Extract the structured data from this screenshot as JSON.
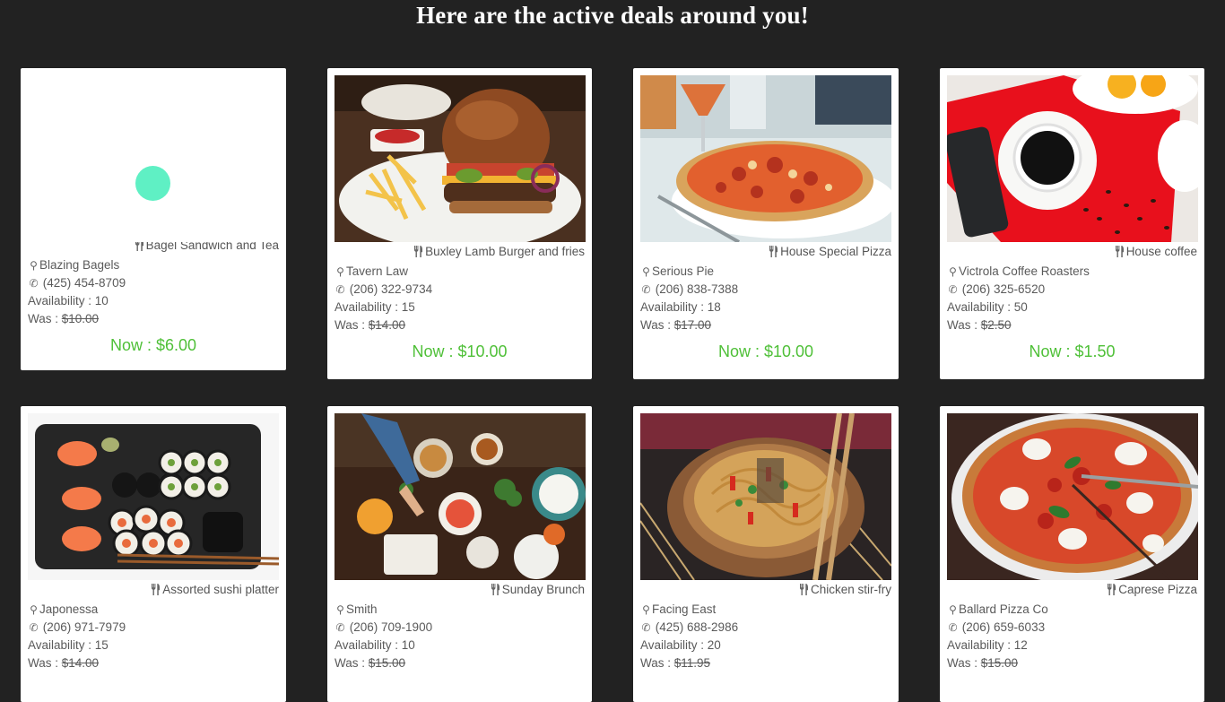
{
  "page": {
    "title": "Here are the active deals around you!"
  },
  "labels": {
    "availability": "Availability : ",
    "was": "Was : ",
    "now": "Now : "
  },
  "colors": {
    "background": "#222222",
    "price_now": "#4fc038",
    "spinner": "#5ff0c4"
  },
  "deals": [
    {
      "deal": "Bagel Sandwich and Tea",
      "restaurant": "Blazing Bagels",
      "phone": "(425) 454-8709",
      "availability": "10",
      "was": "$10.00",
      "now": "$6.00",
      "image": "loading-spinner"
    },
    {
      "deal": "Buxley Lamb Burger and fries",
      "restaurant": "Tavern Law",
      "phone": "(206) 322-9734",
      "availability": "15",
      "was": "$14.00",
      "now": "$10.00",
      "image": "burger-photo"
    },
    {
      "deal": "House Special Pizza",
      "restaurant": "Serious Pie",
      "phone": "(206) 838-7388",
      "availability": "18",
      "was": "$17.00",
      "now": "$10.00",
      "image": "pizza-photo"
    },
    {
      "deal": "House coffee",
      "restaurant": "Victrola Coffee Roasters",
      "phone": "(206) 325-6520",
      "availability": "50",
      "was": "$2.50",
      "now": "$1.50",
      "image": "coffee-photo"
    },
    {
      "deal": "Assorted sushi platter",
      "restaurant": "Japonessa",
      "phone": "(206) 971-7979",
      "availability": "15",
      "was": "$14.00",
      "now": "",
      "image": "sushi-photo"
    },
    {
      "deal": "Sunday Brunch",
      "restaurant": "Smith",
      "phone": "(206) 709-1900",
      "availability": "10",
      "was": "$15.00",
      "now": "",
      "image": "brunch-photo"
    },
    {
      "deal": "Chicken stir-fry",
      "restaurant": "Facing East",
      "phone": "(425) 688-2986",
      "availability": "20",
      "was": "$11.95",
      "now": "",
      "image": "noodles-photo"
    },
    {
      "deal": "Caprese Pizza",
      "restaurant": "Ballard Pizza Co",
      "phone": "(206) 659-6033",
      "availability": "12",
      "was": "$15.00",
      "now": "",
      "image": "caprese-pizza-photo"
    }
  ]
}
